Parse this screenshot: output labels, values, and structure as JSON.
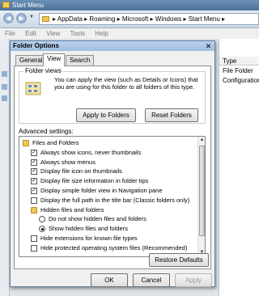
{
  "explorer": {
    "title": "Start Menu",
    "address_path": "▸ AppData ▸ Roaming ▸ Microsoft ▸ Windows ▸ Start Menu ▸",
    "menu": [
      "File",
      "Edit",
      "View",
      "Tools",
      "Help"
    ],
    "column_header": "Type",
    "rows": [
      "File Folder",
      "Configuration"
    ]
  },
  "dialog": {
    "title": "Folder Options",
    "close": "✕",
    "tabs": [
      "General",
      "View",
      "Search"
    ],
    "active_tab": "View",
    "folder_views": {
      "legend": "Folder views",
      "description": "You can apply the view (such as Details or Icons) that you are using for this folder to all folders of this type.",
      "apply_button": "Apply to Folders",
      "reset_button": "Reset Folders"
    },
    "advanced_label": "Advanced settings:",
    "settings": [
      {
        "type": "folder",
        "label": "Files and Folders",
        "indent": 0
      },
      {
        "type": "checkbox",
        "checked": true,
        "label": "Always show icons, never thumbnails",
        "indent": 1
      },
      {
        "type": "checkbox",
        "checked": true,
        "label": "Always show menus",
        "indent": 1
      },
      {
        "type": "checkbox",
        "checked": true,
        "label": "Display file icon on thumbnails",
        "indent": 1
      },
      {
        "type": "checkbox",
        "checked": true,
        "label": "Display file size information in folder tips",
        "indent": 1
      },
      {
        "type": "checkbox",
        "checked": true,
        "label": "Display simple folder view in Navigation pane",
        "indent": 1
      },
      {
        "type": "checkbox",
        "checked": false,
        "label": "Display the full path in the title bar (Classic folders only)",
        "indent": 1
      },
      {
        "type": "folder",
        "label": "Hidden files and folders",
        "indent": 1
      },
      {
        "type": "radio",
        "checked": false,
        "label": "Do not show hidden files and folders",
        "indent": 2
      },
      {
        "type": "radio",
        "checked": true,
        "label": "Show hidden files and folders",
        "indent": 2
      },
      {
        "type": "checkbox",
        "checked": false,
        "label": "Hide extensions for known file types",
        "indent": 1
      },
      {
        "type": "checkbox",
        "checked": false,
        "label": "Hide protected operating system files (Recommended)",
        "indent": 1
      }
    ],
    "restore_button": "Restore Defaults",
    "ok_button": "OK",
    "cancel_button": "Cancel",
    "apply_button": "Apply"
  }
}
